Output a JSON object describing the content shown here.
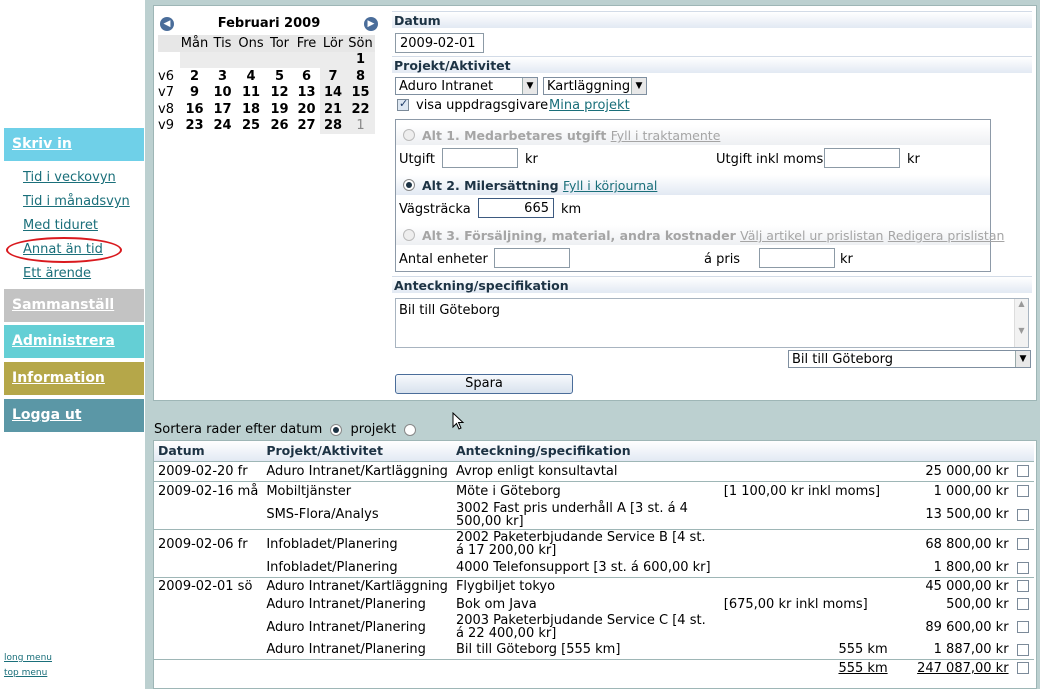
{
  "sidebar": {
    "skriv_in": "Skriv in",
    "links": [
      "Tid i veckovyn",
      "Tid i månadsvyn",
      "Med tiduret",
      "Annat än tid",
      "Ett ärende"
    ],
    "sammanstall": "Sammanställ",
    "administrera": "Administrera",
    "information": "Information",
    "logga_ut": "Logga ut",
    "long_menu": "long menu",
    "top_menu": "top menu"
  },
  "calendar": {
    "title": "Februari 2009",
    "days": [
      "Mån",
      "Tis",
      "Ons",
      "Tor",
      "Fre",
      "Lör",
      "Sön"
    ],
    "weeks": [
      {
        "wk": "",
        "d": [
          "",
          "",
          "",
          "",
          "",
          "",
          "1"
        ]
      },
      {
        "wk": "v6",
        "d": [
          "2",
          "3",
          "4",
          "5",
          "6",
          "7",
          "8"
        ]
      },
      {
        "wk": "v7",
        "d": [
          "9",
          "10",
          "11",
          "12",
          "13",
          "14",
          "15"
        ]
      },
      {
        "wk": "v8",
        "d": [
          "16",
          "17",
          "18",
          "19",
          "20",
          "21",
          "22"
        ]
      },
      {
        "wk": "v9",
        "d": [
          "23",
          "24",
          "25",
          "26",
          "27",
          "28",
          "1"
        ]
      }
    ]
  },
  "form": {
    "datum_head": "Datum",
    "datum_value": "2009-02-01",
    "projekt_head": "Projekt/Aktivitet",
    "projekt_value": "Aduro Intranet",
    "aktivitet_value": "Kartläggning",
    "visa_label": "visa uppdragsgivare",
    "mina_projekt": "Mina projekt",
    "alt1_label": "Alt 1. Medarbetares utgift",
    "alt1_link": "Fyll i traktamente",
    "utgift_label": "Utgift",
    "kr": "kr",
    "utgift_moms_label": "Utgift inkl moms",
    "alt2_label": "Alt 2. Milersättning",
    "alt2_link": "Fyll i körjournal",
    "vagstracka_label": "Vägsträcka",
    "vagstracka_value": "665",
    "km": "km",
    "alt3_label": "Alt 3. Försäljning, material, andra kostnader",
    "alt3_link1": "Välj artikel ur prislistan",
    "alt3_link2": "Redigera prislistan",
    "antal_label": "Antal enheter",
    "apris_label": "á pris",
    "anteckning_head": "Anteckning/specifikation",
    "anteckning_value": "Bil till Göteborg",
    "preset_value": "Bil till Göteborg",
    "save_label": "Spara"
  },
  "sort": {
    "text": "Sortera rader efter datum",
    "projekt": "projekt"
  },
  "table": {
    "headers": [
      "Datum",
      "Projekt/Aktivitet",
      "Anteckning/specifikation"
    ],
    "rows": [
      {
        "datum": "2009-02-20 fr",
        "projekt": "Aduro Intranet/Kartläggning",
        "note": "Avrop enligt konsultavtal",
        "extra": "",
        "amount": "25 000,00 kr",
        "start": true
      },
      {
        "datum": "2009-02-16 må",
        "projekt": "Mobiltjänster",
        "note": "Möte i Göteborg",
        "extra": "[1 100,00 kr inkl moms]",
        "amount": "1 000,00 kr",
        "start": true
      },
      {
        "datum": "",
        "projekt": "SMS-Flora/Analys",
        "note": "3002 Fast pris underhåll A [3 st. á 4 500,00 kr]",
        "extra": "",
        "amount": "13 500,00 kr",
        "start": false
      },
      {
        "datum": "2009-02-06 fr",
        "projekt": "Infobladet/Planering",
        "note": "2002 Paketerbjudande Service B [4 st. á 17 200,00 kr]",
        "extra": "",
        "amount": "68 800,00 kr",
        "start": true
      },
      {
        "datum": "",
        "projekt": "Infobladet/Planering",
        "note": "4000 Telefonsupport [3 st. á 600,00 kr]",
        "extra": "",
        "amount": "1 800,00 kr",
        "start": false
      },
      {
        "datum": "2009-02-01 sö",
        "projekt": "Aduro Intranet/Kartläggning",
        "note": "Flygbiljet tokyo",
        "extra": "",
        "amount": "45 000,00 kr",
        "start": true
      },
      {
        "datum": "",
        "projekt": "Aduro Intranet/Planering",
        "note": "Bok om Java",
        "extra": "[675,00 kr inkl moms]",
        "amount": "500,00 kr",
        "start": false
      },
      {
        "datum": "",
        "projekt": "Aduro Intranet/Planering",
        "note": "2003 Paketerbjudande Service C [4 st. á 22 400,00 kr]",
        "extra": "",
        "amount": "89 600,00 kr",
        "start": false
      },
      {
        "datum": "",
        "projekt": "Aduro Intranet/Planering",
        "note": "Bil till Göteborg [555 km]",
        "extra": "555 km",
        "amount": "1 887,00 kr",
        "start": false
      }
    ],
    "total_km": "555 km",
    "total_amount": "247 087,00 kr"
  }
}
